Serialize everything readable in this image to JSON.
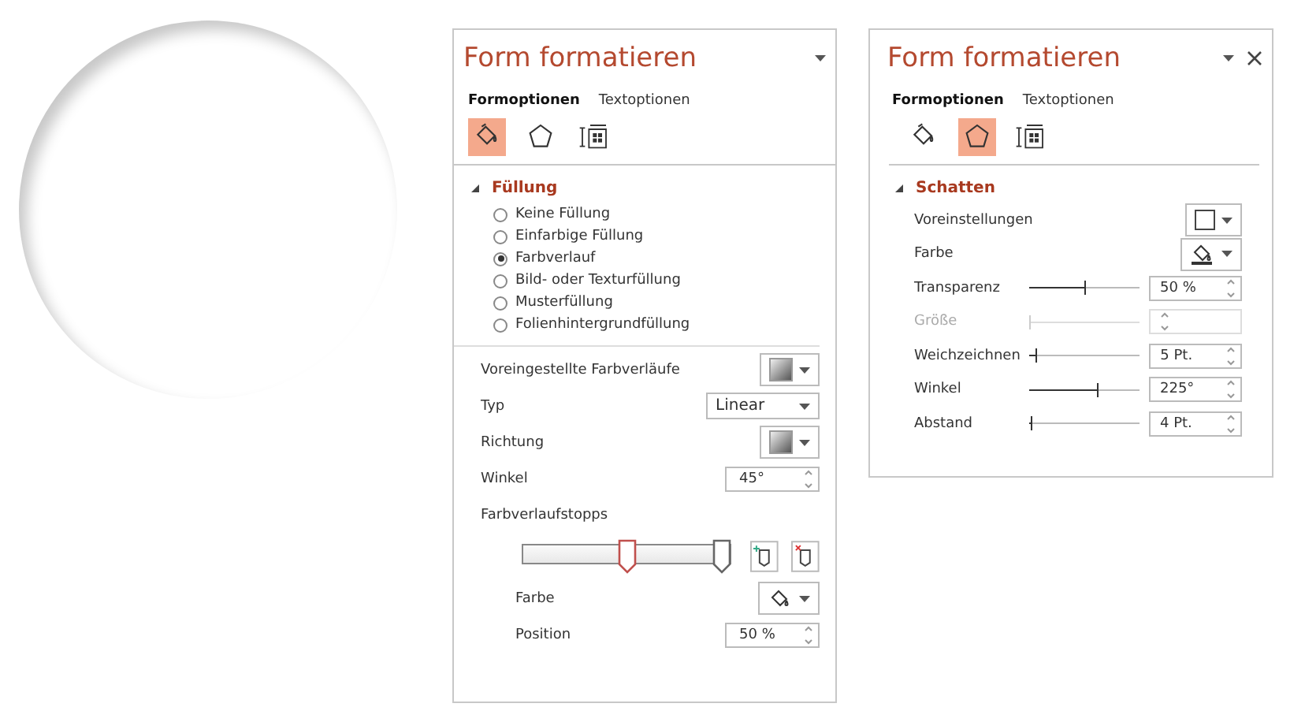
{
  "panels": [
    {
      "title": "Form formatieren",
      "tabs": [
        {
          "label": "Formoptionen",
          "selected": true
        },
        {
          "label": "Textoptionen",
          "selected": false
        }
      ],
      "icon_tabs": [
        {
          "kind": "fill",
          "selected": true
        },
        {
          "kind": "effects",
          "selected": false
        },
        {
          "kind": "size",
          "selected": false
        }
      ],
      "section": {
        "title": "Füllung",
        "expanded": true
      },
      "options": [
        {
          "label": "Keine Füllung",
          "selected": false
        },
        {
          "label": "Einfarbige Füllung",
          "selected": false
        },
        {
          "label": "Farbverlauf",
          "selected": true
        },
        {
          "label": "Bild- oder Texturfüllung",
          "selected": false
        },
        {
          "label": "Musterfüllung",
          "selected": false
        },
        {
          "label": "Folienhintergrundfüllung",
          "selected": false
        }
      ],
      "rows": [
        {
          "kind": "gradient-picker",
          "label": "Voreingestellte Farbverläufe",
          "indented": false
        },
        {
          "kind": "select",
          "label": "Typ",
          "value": "Linear",
          "indented": false
        },
        {
          "kind": "gradient-picker",
          "label": "Richtung",
          "indented": false
        },
        {
          "kind": "spin",
          "label": "Winkel",
          "value": "45°",
          "indented": false
        },
        {
          "kind": "heading",
          "label": "Farbverlaufstopps",
          "indented": false
        },
        {
          "kind": "stops",
          "stops": [
            {
              "level": 0.5,
              "selected": true
            },
            {
              "level": 1,
              "selected": false
            }
          ]
        },
        {
          "kind": "color-picker",
          "label": "Farbe",
          "indented": true
        },
        {
          "kind": "spin",
          "label": "Position",
          "value": "50 %",
          "indented": true
        }
      ]
    },
    {
      "title": "Form formatieren",
      "close": true,
      "tabs": [
        {
          "label": "Formoptionen",
          "selected": true
        },
        {
          "label": "Textoptionen",
          "selected": false
        }
      ],
      "icon_tabs": [
        {
          "kind": "fill",
          "selected": false
        },
        {
          "kind": "effects",
          "selected": true
        },
        {
          "kind": "size",
          "selected": false
        }
      ],
      "section": {
        "title": "Schatten",
        "expanded": true
      },
      "rows": [
        {
          "kind": "shadow-picker",
          "label": "Voreinstellungen",
          "indented": false
        },
        {
          "kind": "line-color-picker",
          "label": "Farbe",
          "indented": false
        },
        {
          "kind": "slider",
          "label": "Transparenz",
          "level": 0.5,
          "value": "50 %",
          "disabled": false
        },
        {
          "kind": "slider",
          "label": "Größe",
          "level": 0,
          "disabled": true
        },
        {
          "kind": "slider",
          "label": "Weichzeichnen",
          "level": 0.05,
          "value": "5 Pt.",
          "disabled": false
        },
        {
          "kind": "slider",
          "label": "Winkel",
          "level": 0.62,
          "value": "225°",
          "disabled": false
        },
        {
          "kind": "slider",
          "label": "Abstand",
          "level": 0.02,
          "value": "4 Pt.",
          "disabled": false
        }
      ]
    }
  ]
}
